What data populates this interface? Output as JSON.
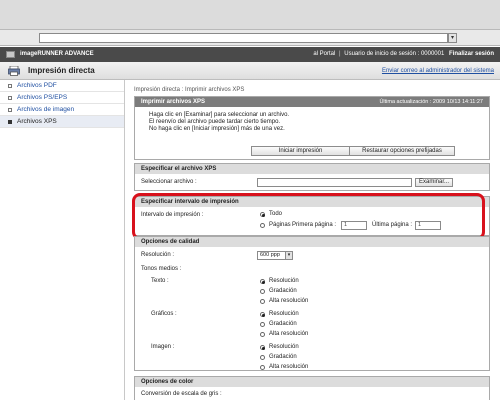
{
  "browser": {
    "address_value": "",
    "dropdown_icon": "triangle-down"
  },
  "header": {
    "product": "imageRUNNER ADVANCE",
    "portal_link": "al Portal",
    "login_user": "Usuario de inicio de sesión : 0000001",
    "logout": "Finalizar sesión"
  },
  "subheader": {
    "title": "Impresión directa",
    "send_link": "Enviar correo al administrador del sistema"
  },
  "sidebar": {
    "items": [
      {
        "label": "Archivos PDF"
      },
      {
        "label": "Archivos PS/EPS"
      },
      {
        "label": "Archivos de imagen"
      },
      {
        "label": "Archivos XPS"
      }
    ]
  },
  "main": {
    "breadcrumb": "Impresión directa : Imprimir archivos XPS",
    "info": {
      "title": "Imprimir archivos XPS",
      "updated": "Última actualización : 2009 10/13 14:11:27",
      "line1": "Haga clic en [Examinar] para seleccionar un archivo.",
      "line2": "El reenvío del archivo puede tardar cierto tiempo.",
      "line3": "No haga clic en [Iniciar impresión] más de una vez.",
      "start_button": "Iniciar impresión",
      "restore_button": "Restaurar opciones prefijadas"
    },
    "file": {
      "title": "Especificar el archivo XPS",
      "label": "Seleccionar archivo :",
      "browse_button": "Examinar..."
    },
    "range": {
      "title": "Especificar intervalo de impresión",
      "label": "Intervalo de impresión :",
      "all": "Todo",
      "pages": "Páginas",
      "first_label": "Primera página :",
      "first_value": "1",
      "last_label": "Última página :",
      "last_value": "1"
    },
    "quality": {
      "title": "Opciones de calidad",
      "resolution_label": "Resolución :",
      "resolution_value": "600 ppp",
      "halftones_label": "Tonos medios :",
      "groups": [
        {
          "label": "Texto :",
          "options": [
            "Resolución",
            "Gradación",
            "Alta resolución"
          ]
        },
        {
          "label": "Gráficos :",
          "options": [
            "Resolución",
            "Gradación",
            "Alta resolución"
          ]
        },
        {
          "label": "Imagen :",
          "options": [
            "Resolución",
            "Gradación",
            "Alta resolución"
          ]
        }
      ]
    },
    "color": {
      "title": "Opciones de color",
      "grayscale_label": "Conversión de escala de gris :"
    }
  }
}
